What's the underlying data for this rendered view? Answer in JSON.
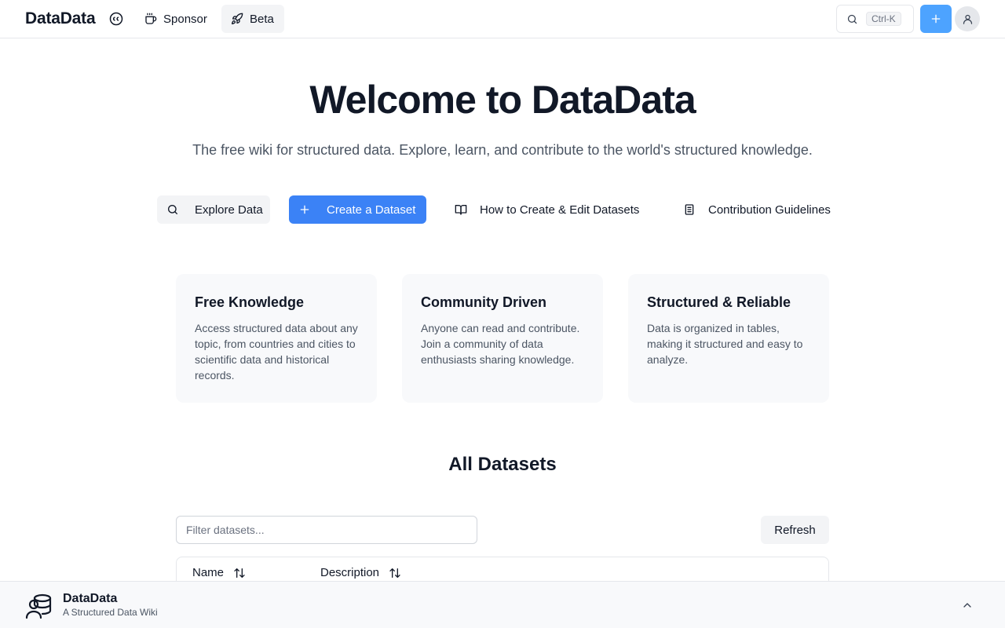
{
  "header": {
    "brand": "DataData",
    "nav": [
      {
        "label": "Sponsor",
        "icon": "coffee-icon"
      },
      {
        "label": "Beta",
        "icon": "rocket-icon"
      }
    ],
    "search_shortcut": "Ctrl-K",
    "accent_color": "#4da3ff"
  },
  "hero": {
    "title": "Welcome to DataData",
    "subtitle": "The free wiki for structured data. Explore, learn, and contribute to the world's structured knowledge.",
    "actions": [
      {
        "label": "Explore Data",
        "icon": "search-icon"
      },
      {
        "label": "Create a Dataset",
        "icon": "plus-icon",
        "color": "#3b82f6"
      },
      {
        "label": "How to Create & Edit Datasets",
        "icon": "book-open-icon"
      },
      {
        "label": "Contribution Guidelines",
        "icon": "document-icon"
      }
    ]
  },
  "features": [
    {
      "title": "Free Knowledge",
      "text": "Access structured data about any topic, from countries and cities to scientific data and historical records."
    },
    {
      "title": "Community Driven",
      "text": "Anyone can read and contribute. Join a community of data enthusiasts sharing knowledge."
    },
    {
      "title": "Structured & Reliable",
      "text": "Data is organized in tables, making it structured and easy to analyze."
    }
  ],
  "datasets": {
    "title": "All Datasets",
    "filter_placeholder": "Filter datasets...",
    "refresh_label": "Refresh",
    "columns": [
      "Name",
      "Description"
    ]
  },
  "footer": {
    "name": "DataData",
    "tagline": "A Structured Data Wiki"
  }
}
